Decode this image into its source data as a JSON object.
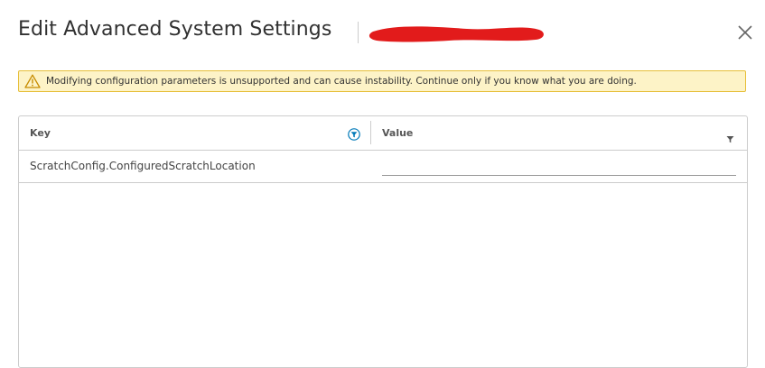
{
  "dialog": {
    "title": "Edit Advanced System Settings"
  },
  "alert": {
    "message": "Modifying configuration parameters is unsupported and can cause instability. Continue only if you know what you are doing.",
    "icon": "warning-icon"
  },
  "grid": {
    "columns": {
      "key": "Key",
      "value": "Value"
    },
    "rows": [
      {
        "key": "ScratchConfig.ConfiguredScratchLocation",
        "value": ""
      }
    ]
  },
  "colors": {
    "alert_bg": "#fdf3c7",
    "alert_border": "#e7bf3a",
    "filter_active": "#0079b8",
    "redaction": "#e21b1b"
  }
}
